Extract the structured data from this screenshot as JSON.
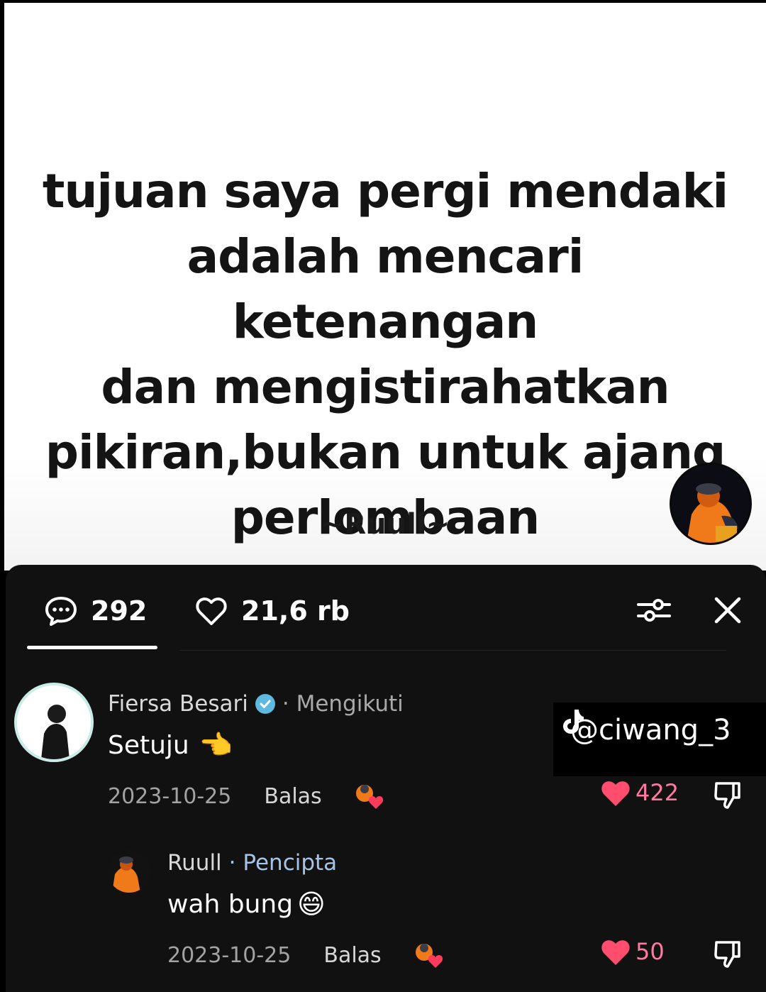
{
  "quote": {
    "lines": [
      "tujuan saya pergi mendaki",
      "adalah mencari ketenangan",
      "dan mengistirahatkan",
      "pikiran,bukan untuk ajang",
      "perlombaan"
    ],
    "signature": "~Ruull~"
  },
  "tabs": {
    "comments_count": "292",
    "likes_count": "21,6 rb",
    "active_tab": "comments",
    "icons": [
      "comment-icon",
      "heart-outline-icon",
      "filter-sliders-icon",
      "close-icon"
    ]
  },
  "comments": [
    {
      "author": "Fiersa Besari",
      "verified": true,
      "meta": "· Mengikuti",
      "text": "Setuju",
      "emoji": "👈",
      "date": "2023-10-25",
      "reply_label": "Balas",
      "likes": "422"
    },
    {
      "author": "Ruull",
      "meta": "· Pencipta",
      "text": "wah bung",
      "emoji": "😄",
      "date": "2023-10-25",
      "reply_label": "Balas",
      "likes": "50"
    }
  ],
  "watermark": {
    "handle": "@ciwang_3",
    "icon": "tiktok-logo-icon"
  },
  "colors": {
    "panel": "#111112",
    "like": "#ff4d6d",
    "verified": "#5fb8de"
  }
}
